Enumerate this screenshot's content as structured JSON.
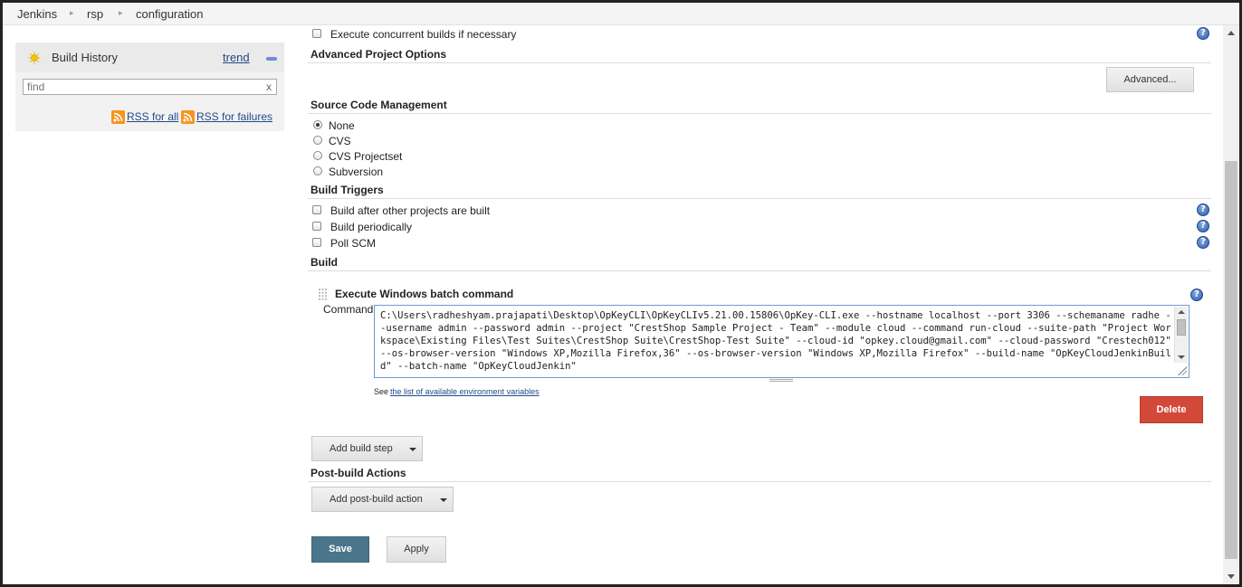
{
  "breadcrumb": [
    "Jenkins",
    "rsp",
    "configuration"
  ],
  "sidebar": {
    "title": "Build History",
    "trend": "trend",
    "find_placeholder": "find",
    "find_clear": "x",
    "rss_all": "RSS for all",
    "rss_failures": "RSS for failures"
  },
  "main": {
    "concurrent_label": "Execute concurrent builds if necessary",
    "advanced_options_title": "Advanced Project Options",
    "advanced_button": "Advanced...",
    "scm_title": "Source Code Management",
    "scm_options": [
      "None",
      "CVS",
      "CVS Projectset",
      "Subversion"
    ],
    "scm_selected": "None",
    "triggers_title": "Build Triggers",
    "triggers": [
      "Build after other projects are built",
      "Build periodically",
      "Poll SCM"
    ],
    "build_title": "Build",
    "build_step_title": "Execute Windows batch command",
    "command_label": "Command",
    "command_value": "C:\\Users\\radheshyam.prajapati\\Desktop\\OpKeyCLI\\OpKeyCLIv5.21.00.15806\\OpKey-CLI.exe --hostname localhost --port 3306 --schemaname radhe --username admin --password admin --project \"CrestShop Sample Project - Team\" --module cloud --command run-cloud --suite-path \"Project Workspace\\Existing Files\\Test Suites\\CrestShop Suite\\CrestShop-Test Suite\" --cloud-id \"opkey.cloud@gmail.com\" --cloud-password \"Crestech012\" --os-browser-version \"Windows XP,Mozilla Firefox,36\" --os-browser-version \"Windows XP,Mozilla Firefox\" --build-name \"OpKeyCloudJenkinBuild\" --batch-name \"OpKeyCloudJenkin\"",
    "env_see": "See",
    "env_link": "the list of available environment variables",
    "delete_button": "Delete",
    "add_build_step": "Add build step",
    "post_build_title": "Post-build Actions",
    "add_post_build": "Add post-build action",
    "save_button": "Save",
    "apply_button": "Apply",
    "help_glyph": "?"
  },
  "colors": {
    "save_bg": "#4b758b",
    "delete_bg": "#d24939",
    "link": "#204a87",
    "rss": "#f7941d"
  }
}
